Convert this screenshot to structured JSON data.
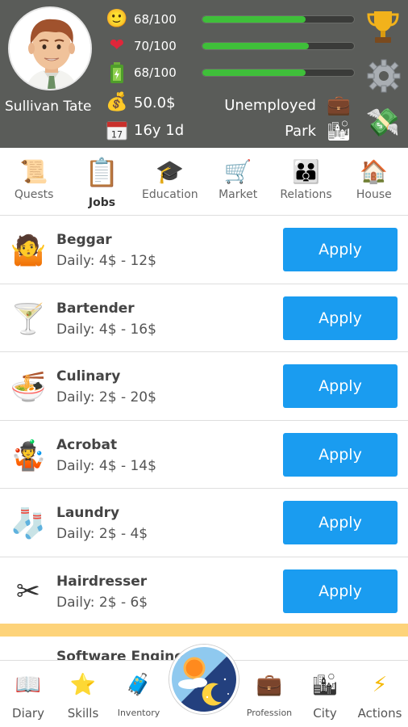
{
  "player": {
    "name": "Sullivan Tate",
    "money": "50.0$",
    "age": "16y 1d",
    "job_status": "Unemployed",
    "location": "Park"
  },
  "stats": [
    {
      "name": "happiness",
      "icon": "smiley-face-icon",
      "value": "68/100",
      "fraction": 0.68
    },
    {
      "name": "health",
      "icon": "heart-icon",
      "value": "70/100",
      "fraction": 0.7
    },
    {
      "name": "energy",
      "icon": "battery-icon",
      "value": "68/100",
      "fraction": 0.68
    }
  ],
  "tabs": [
    {
      "label": "Quests",
      "icon": "scroll-icon"
    },
    {
      "label": "Jobs",
      "icon": "clipboard-icon",
      "active": true
    },
    {
      "label": "Education",
      "icon": "graduation-cap-icon"
    },
    {
      "label": "Market",
      "icon": "shopping-cart-icon"
    },
    {
      "label": "Relations",
      "icon": "family-icon"
    },
    {
      "label": "House",
      "icon": "house-icon"
    }
  ],
  "jobs": [
    {
      "name": "Beggar",
      "pay": "Daily: 4$ - 12$",
      "icon": "shrugging-person-icon",
      "button": "Apply"
    },
    {
      "name": "Bartender",
      "pay": "Daily: 4$ - 16$",
      "icon": "cocktail-glass-icon",
      "button": "Apply"
    },
    {
      "name": "Culinary",
      "pay": "Daily: 2$ - 20$",
      "icon": "soup-bowl-icon",
      "button": "Apply"
    },
    {
      "name": "Acrobat",
      "pay": "Daily: 4$ - 14$",
      "icon": "juggler-icon",
      "button": "Apply"
    },
    {
      "name": "Laundry",
      "pay": "Daily: 2$ - 4$",
      "icon": "sock-icon",
      "button": "Apply"
    },
    {
      "name": "Hairdresser",
      "pay": "Daily: 2$ - 6$",
      "icon": "scissors-icon",
      "button": "Apply"
    }
  ],
  "partial_job": "Software Enginee",
  "bottom_nav": [
    {
      "label": "Diary",
      "icon": "book-icon"
    },
    {
      "label": "Skills",
      "icon": "star-icon"
    },
    {
      "label": "Inventory",
      "icon": "luggage-icon"
    },
    {
      "label": "Profession",
      "icon": "briefcase-icon"
    },
    {
      "label": "City",
      "icon": "cityscape-icon"
    },
    {
      "label": "Actions",
      "icon": "lightning-icon"
    }
  ],
  "colors": {
    "header_bg": "#5a5c59",
    "bar_fill": "#3fbf3a",
    "apply_button": "#1a9cf0",
    "divider_bar": "#fdd37a"
  }
}
